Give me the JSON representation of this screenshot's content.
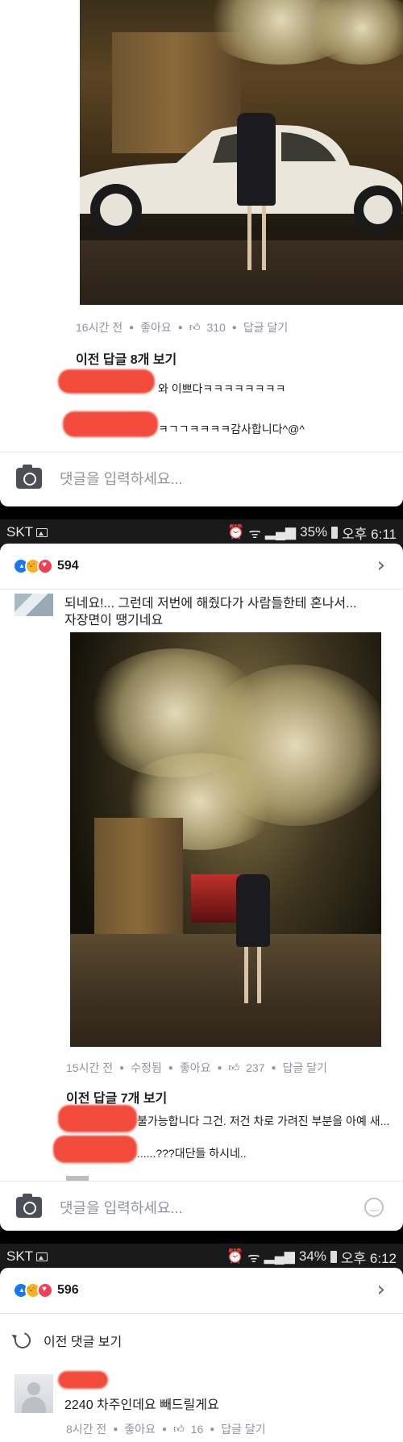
{
  "post1": {
    "meta": {
      "time": "16시간 전",
      "like": "좋아요",
      "count": "310",
      "reply": "답글 달기"
    },
    "prev_replies": "이전 답글 8개 보기",
    "replies": [
      {
        "text": "와 이쁘다ㅋㅋㅋㅋㅋㅋㅋㅋ"
      },
      {
        "text": "ㅋㄱㄱㅋㅋㅋㅋ감사합니다^@^"
      }
    ],
    "comment_placeholder": "댓글을 입력하세요..."
  },
  "status1": {
    "carrier": "SKT",
    "battery": "35%",
    "time": "오후 6:11"
  },
  "post2": {
    "reaction_count": "594",
    "comment_lines": [
      "되네요!... 그런데 저번에 해줬다가 사람들한테 혼나서...",
      "자장면이 땡기네요"
    ],
    "meta": {
      "time": "15시간 전",
      "edited": "수정됨",
      "like": "좋아요",
      "count": "237",
      "reply": "답글 달기"
    },
    "prev_replies": "이전 답글 7개 보기",
    "replies": [
      {
        "text": "불가능합니다 그건. 저건 차로 가려진 부분을 아예 새..."
      },
      {
        "text": "......???대단들 하시네.."
      }
    ],
    "comment_placeholder": "댓글을 입력하세요..."
  },
  "status2": {
    "carrier": "SKT",
    "battery": "34%",
    "time": "오후 6:12"
  },
  "post3": {
    "reaction_count": "596",
    "prev_comments": "이전 댓글 보기",
    "comment": "2240 차주인데요 빼드릴게요",
    "meta": {
      "time": "8시간 전",
      "like": "좋아요",
      "count": "16",
      "reply": "답글 달기"
    }
  },
  "colors": {
    "accent": "#1877f2",
    "redaction": "#f24b3b",
    "meta_gray": "#90949c"
  }
}
